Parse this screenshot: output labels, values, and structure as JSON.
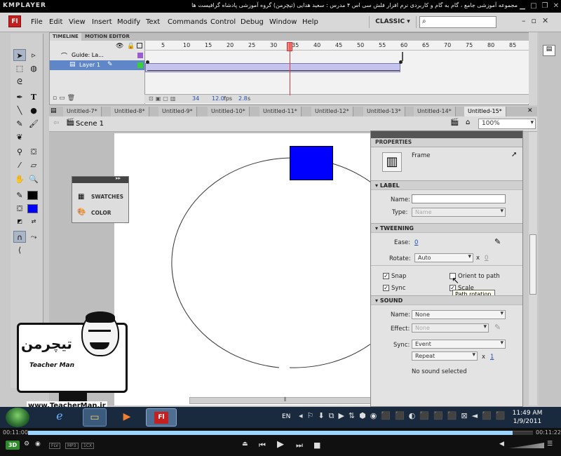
{
  "player": {
    "logo": "KMPLAYER",
    "title": "مجموعه آموزشی جامع ، گام به گام و کاربردی نرم افزار فلش سی اس ۴ مدرس : سعید هدایی (تیچرمن) گروه آموزشی پادشاه گرافیست ها",
    "time_elapsed": "00:11:00",
    "time_total": "00:11:22",
    "progress": 0.96,
    "badges": [
      "FLV",
      "MP3",
      "1CX"
    ]
  },
  "app": {
    "logo": "Fl",
    "menu": [
      "File",
      "Edit",
      "View",
      "Insert",
      "Modify",
      "Text",
      "Commands",
      "Control",
      "Debug",
      "Window",
      "Help"
    ],
    "workspace": "CLASSIC",
    "search_placeholder": ""
  },
  "timeline": {
    "tabs": [
      "TIMELINE",
      "MOTION EDITOR"
    ],
    "layers": [
      {
        "name": "Guide: La...",
        "type": "guide"
      },
      {
        "name": "Layer 1",
        "type": "normal",
        "selected": true
      }
    ],
    "frame_numbers": [
      "5",
      "10",
      "15",
      "20",
      "25",
      "30",
      "35",
      "40",
      "45",
      "50",
      "55",
      "60",
      "65",
      "70",
      "75",
      "80",
      "85"
    ],
    "current_frame": "34",
    "fps": "12.0",
    "fps_unit": "fps",
    "time": "2.8",
    "time_unit": "s"
  },
  "documents": [
    "Untitled-7*",
    "Untitled-8*",
    "Untitled-9*",
    "Untitled-10*",
    "Untitled-11*",
    "Untitled-12*",
    "Untitled-13*",
    "Untitled-14*",
    "Untitled-15*"
  ],
  "active_document": "Untitled-15*",
  "editbar": {
    "scene": "Scene 1",
    "zoom": "100%"
  },
  "panels": {
    "swatches": "SWATCHES",
    "color": "COLOR"
  },
  "properties": {
    "header": "PROPERTIES",
    "type": "Frame",
    "label_section": "LABEL",
    "name_label": "Name:",
    "name_value": "",
    "type_label": "Type:",
    "type_value": "Name",
    "tweening_section": "TWEENING",
    "ease_label": "Ease:",
    "ease_value": "0",
    "rotate_label": "Rotate:",
    "rotate_value": "Auto",
    "rotate_times_sign": "x",
    "rotate_times": "0",
    "snap_label": "Snap",
    "sync_label": "Sync",
    "orient_label": "Orient to path",
    "scale_label": "Scale",
    "tooltip": "Path rotation",
    "sound_section": "SOUND",
    "sound_name_label": "Name:",
    "sound_name_value": "None",
    "effect_label": "Effect:",
    "effect_value": "None",
    "sync2_label": "Sync:",
    "sync2_value": "Event",
    "repeat_value": "Repeat",
    "repeat_times_sign": "x",
    "repeat_count": "1",
    "status": "No sound selected"
  },
  "watermark": {
    "site": "www.TeacherMan.ir",
    "name": "Teacher Man",
    "persian": "تیچرمن"
  },
  "taskbar": {
    "lang": "EN",
    "time": "11:49 AM",
    "date": "1/9/2011"
  },
  "colors": {
    "stage_square": "#0000ff",
    "fill_swatch": "#0000ff",
    "stroke_swatch": "#000000",
    "playhead": "#e33333"
  }
}
